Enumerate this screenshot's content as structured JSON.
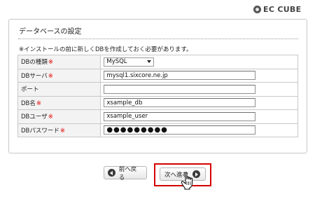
{
  "logo": {
    "text": "EC CUBE"
  },
  "panel": {
    "title": "データベースの設定",
    "notice": "※インストールの前に新しくDBを作成しておく必要があります。"
  },
  "form": {
    "required_mark": "※",
    "rows": [
      {
        "label": "DBの種類",
        "required": true,
        "type": "select",
        "value": "MySQL"
      },
      {
        "label": "DBサーバ",
        "required": true,
        "type": "text",
        "value": "mysql1.sixcore.ne.jp"
      },
      {
        "label": "ポート",
        "required": false,
        "type": "text",
        "value": ""
      },
      {
        "label": "DB名",
        "required": true,
        "type": "text",
        "value": "xsample_db"
      },
      {
        "label": "DBユーザ",
        "required": true,
        "type": "text",
        "value": "xsample_user"
      },
      {
        "label": "DBパスワード",
        "required": true,
        "type": "password",
        "value": "●●●●●●●●●"
      }
    ]
  },
  "buttons": {
    "back_label": "前へ戻る",
    "next_label": "次へ進む"
  },
  "colors": {
    "required": "#e00000",
    "highlight": "#d40000",
    "label_bg": "#f3f3f3"
  }
}
